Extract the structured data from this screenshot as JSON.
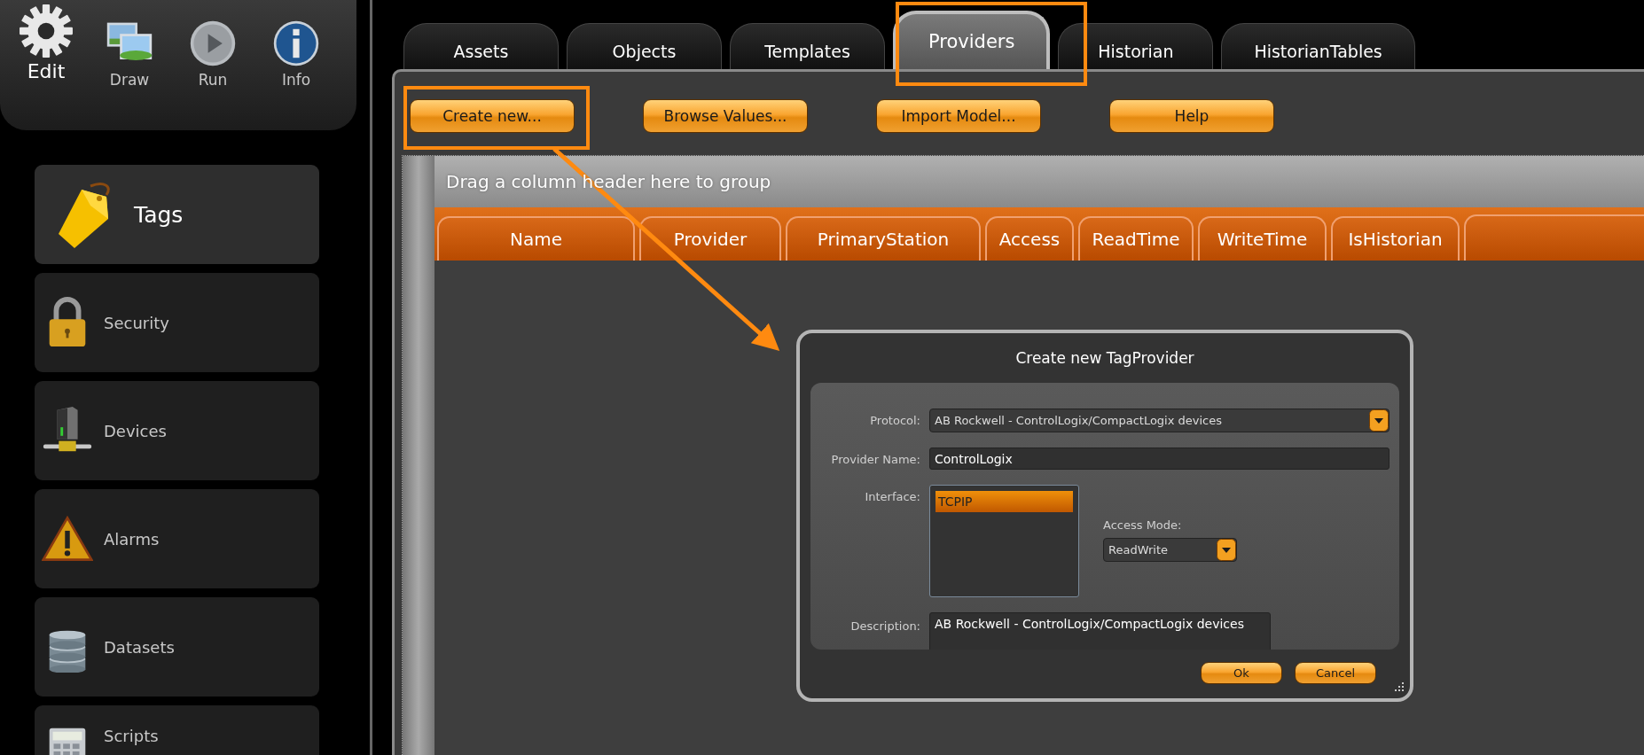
{
  "toolbar": [
    {
      "label": "Edit",
      "kind": "gear",
      "selected": true
    },
    {
      "label": "Draw",
      "kind": "pictures",
      "selected": false
    },
    {
      "label": "Run",
      "kind": "play",
      "selected": false
    },
    {
      "label": "Info",
      "kind": "info",
      "selected": false
    }
  ],
  "sidebar": {
    "items": [
      {
        "label": "Tags",
        "kind": "tag",
        "selected": true
      },
      {
        "label": "Security",
        "kind": "padlock",
        "selected": false
      },
      {
        "label": "Devices",
        "kind": "device",
        "selected": false
      },
      {
        "label": "Alarms",
        "kind": "warning",
        "selected": false
      },
      {
        "label": "Datasets",
        "kind": "database",
        "selected": false
      },
      {
        "label": "Scripts",
        "kind": "calculator",
        "selected": false
      }
    ]
  },
  "tabs": [
    {
      "label": "Assets",
      "selected": false
    },
    {
      "label": "Objects",
      "selected": false
    },
    {
      "label": "Templates",
      "selected": false
    },
    {
      "label": "Providers",
      "selected": true
    },
    {
      "label": "Historian",
      "selected": false
    },
    {
      "label": "HistorianTables",
      "selected": false
    }
  ],
  "actions": [
    "Create new...",
    "Browse Values...",
    "Import Model...",
    "Help"
  ],
  "grid": {
    "group_panel": "Drag a column header here to group",
    "columns": [
      "Name",
      "Provider",
      "PrimaryStation",
      "Access",
      "ReadTime",
      "WriteTime",
      "IsHistorian"
    ]
  },
  "dialog": {
    "title": "Create new TagProvider",
    "protocol": {
      "label": "Protocol:",
      "value": "AB Rockwell - ControlLogix/CompactLogix devices"
    },
    "provider_name": {
      "label": "Provider Name:",
      "value": "ControlLogix"
    },
    "interface": {
      "label": "Interface:",
      "items": [
        {
          "label": "TCPIP",
          "selected": true
        }
      ]
    },
    "access_mode": {
      "label": "Access Mode:",
      "value": "ReadWrite"
    },
    "description": {
      "label": "Description:",
      "value": "AB Rockwell - ControlLogix/CompactLogix devices"
    },
    "buttons": [
      "Ok",
      "Cancel"
    ]
  }
}
